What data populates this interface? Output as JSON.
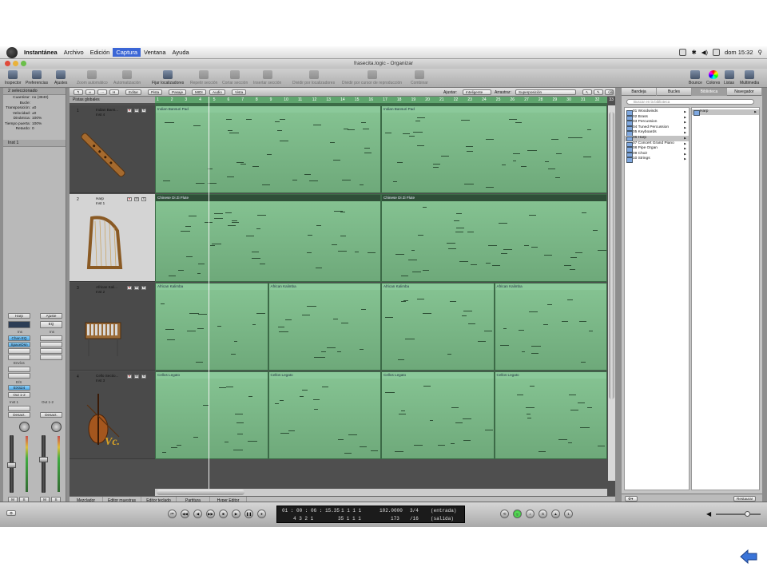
{
  "menubar": {
    "app": "Instantánea",
    "items": [
      "Archivo",
      "Edición",
      "Captura",
      "Ventana",
      "Ayuda"
    ],
    "selected": "Captura",
    "clock": "dom 15:32"
  },
  "window": {
    "title": "frasecita.logic - Organizar"
  },
  "toolbar": {
    "items": [
      "Inspector",
      "Preferencias",
      "Ajustes",
      "Zoom automático",
      "Automatización",
      "Fijar localizadores",
      "Repetir sección",
      "Cortar sección",
      "Insertar sección",
      "Dividir por localizadores",
      "Dividir por cursor de reproducción",
      "Combinar"
    ],
    "right_items": [
      "Bounce",
      "Colores",
      "Listas",
      "Multimedia"
    ]
  },
  "inspector": {
    "header": "2 seleccionado",
    "params": [
      {
        "k": "Cuantizar:",
        "v": "no (3840)"
      },
      {
        "k": "Bucle:",
        "v": ""
      },
      {
        "k": "Transposición:",
        "v": "±0"
      },
      {
        "k": "Velocidad:",
        "v": "±0"
      },
      {
        "k": "Dinámica:",
        "v": "100%"
      },
      {
        "k": "Tiempo puerta:",
        "v": "100%"
      },
      {
        "k": "Retardo:",
        "v": "0"
      }
    ],
    "inst_header": "Inst 1",
    "strip_labels": [
      "Harp",
      "Ajuste",
      "EQ",
      "Ins",
      "Chan EQ",
      "SpaceDsn",
      "Envíos",
      "E/S",
      "EXS24",
      "Out 1-2",
      "Inst 1",
      "Out 1-2",
      "Desact.",
      "Desact.",
      "Inst 1",
      "Out 1-2",
      "Envíos"
    ]
  },
  "arrange": {
    "menus": [
      "Editar",
      "Pista",
      "Pasaje",
      "MIDI",
      "Audio",
      "Vista"
    ],
    "ajustar_label": "Ajustar:",
    "ajustar_value": "Inteligente",
    "arrastrar_label": "Arrastrar:",
    "arrastrar_value": "Superposición",
    "globals": "Pistas globales",
    "ruler": [
      "1",
      "2",
      "3",
      "4",
      "5",
      "6",
      "7",
      "8",
      "9",
      "10",
      "11",
      "12",
      "13",
      "14",
      "15",
      "16",
      "17",
      "18",
      "19",
      "20",
      "21",
      "22",
      "23",
      "24",
      "25",
      "26",
      "27",
      "28",
      "29",
      "30",
      "31",
      "32",
      "33"
    ],
    "tracks": [
      {
        "num": "1",
        "name": "Indian Bans...",
        "inst": "Inst 4",
        "regions": [
          "Indian Bansuri Pad",
          "Indian Bansuri Pad"
        ]
      },
      {
        "num": "2",
        "name": "Harp",
        "inst": "Inst 1",
        "regions": [
          "Chinese Di Zi Flute",
          "Chinese Di Zi Flute"
        ]
      },
      {
        "num": "3",
        "name": "African Kali...",
        "inst": "Inst 2",
        "regions": [
          "African Kalimba",
          "African Kalimba",
          "African Kalimba",
          "African Kalimba"
        ]
      },
      {
        "num": "4",
        "name": "Cello Sectio...",
        "inst": "Inst 3",
        "regions": [
          "Cellos Legato",
          "Cellos Legato",
          "Cellos Legato",
          "Cellos Legato"
        ]
      }
    ],
    "tabs": [
      "Mezclador",
      "Editor muestras",
      "Editor teclado",
      "Partitura",
      "Hyper Editor"
    ]
  },
  "library": {
    "tabs": [
      "Bandeja",
      "Bucles",
      "Biblioteca",
      "Navegador"
    ],
    "selected_tab": "Biblioteca",
    "search_placeholder": "Buscar en la biblioteca",
    "items": [
      "01 Woodwinds",
      "02 Brass",
      "03 Percussion",
      "04 Tuned Percussion",
      "05 Keyboards",
      "06 Harp",
      "07 Concert Grand Piano",
      "08 Pipe Organ",
      "09 Choir",
      "10 Strings"
    ],
    "selected": "06 Harp",
    "sub_items": [
      "Harp"
    ],
    "restore": "Restaurar"
  },
  "transport": {
    "time": "01 : 00 : 06 : 15.35",
    "bars": "4   3   2   1",
    "pos1": "1   1   1   1",
    "pos2": "35   1   1   1",
    "tempo": "102.0000",
    "sig": "3/4",
    "tempo2": "173",
    "div": "/16",
    "in": "(entrada)",
    "out": "(salida)"
  }
}
